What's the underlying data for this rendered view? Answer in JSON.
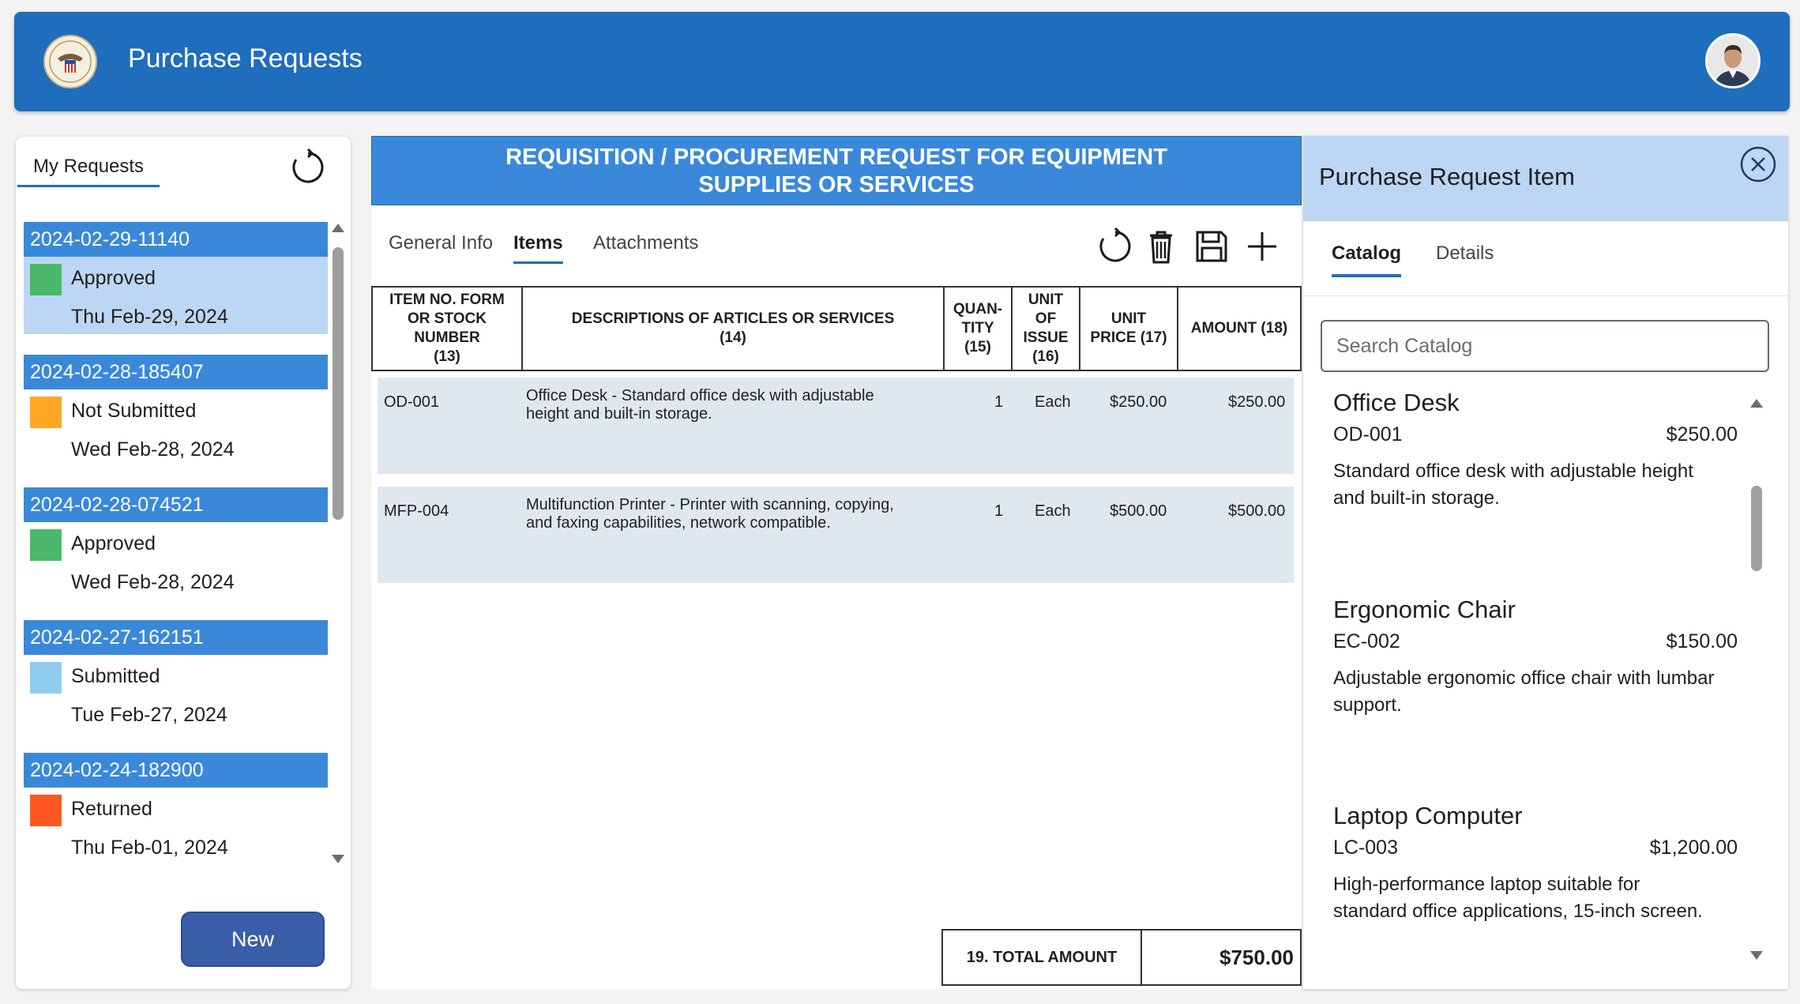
{
  "app": {
    "title": "Purchase Requests",
    "header_color": "#1f6dbd"
  },
  "left": {
    "tab_label": "My Requests",
    "requests": [
      {
        "id": "2024-02-29-11140",
        "status": "Approved",
        "date": "Thu Feb-29, 2024",
        "status_color": "#4cb86b",
        "selected": true
      },
      {
        "id": "2024-02-28-185407",
        "status": "Not Submitted",
        "date": "Wed Feb-28, 2024",
        "status_color": "#ffa726",
        "selected": false
      },
      {
        "id": "2024-02-28-074521",
        "status": "Approved",
        "date": "Wed Feb-28, 2024",
        "status_color": "#4cb86b",
        "selected": false
      },
      {
        "id": "2024-02-27-162151",
        "status": "Submitted",
        "date": "Tue Feb-27, 2024",
        "status_color": "#8fcdee",
        "selected": false
      },
      {
        "id": "2024-02-24-182900",
        "status": "Returned",
        "date": "Thu Feb-01, 2024",
        "status_color": "#ff5722",
        "selected": false
      }
    ],
    "new_button": "New"
  },
  "center": {
    "banner_line1": "REQUISITION / PROCUREMENT REQUEST FOR EQUIPMENT",
    "banner_line2": "SUPPLIES OR SERVICES",
    "tabs": [
      "General Info",
      "Items",
      "Attachments"
    ],
    "active_tab": "Items",
    "toolbar_icons": [
      "refresh-icon",
      "trash-icon",
      "save-icon",
      "add-icon"
    ],
    "columns": {
      "item_no": [
        "ITEM NO. FORM",
        "OR STOCK",
        "NUMBER",
        "(13)"
      ],
      "desc": [
        "DESCRIPTIONS OF ARTICLES OR SERVICES",
        "(14)"
      ],
      "qty": [
        "QUAN-",
        "TITY",
        "(15)"
      ],
      "unit_issue": [
        "UNIT",
        "OF",
        "ISSUE",
        "(16)"
      ],
      "unit_price": [
        "UNIT",
        "PRICE (17)"
      ],
      "amount": [
        "AMOUNT (18)"
      ]
    },
    "items": [
      {
        "item_no": "OD-001",
        "desc1": "Office Desk - Standard office desk with adjustable",
        "desc2": "height and built-in storage.",
        "qty": "1",
        "unit": "Each",
        "unit_price": "$250.00",
        "amount": "$250.00"
      },
      {
        "item_no": "MFP-004",
        "desc1": "Multifunction Printer - Printer with scanning, copying,",
        "desc2": "and faxing capabilities, network compatible.",
        "qty": "1",
        "unit": "Each",
        "unit_price": "$500.00",
        "amount": "$500.00"
      }
    ],
    "total_label": "19. TOTAL AMOUNT",
    "total_value": "$750.00"
  },
  "right": {
    "title": "Purchase Request Item",
    "tabs": [
      "Catalog",
      "Details"
    ],
    "active_tab": "Catalog",
    "search_placeholder": "Search Catalog",
    "catalog": [
      {
        "name": "Office Desk",
        "sku": "OD-001",
        "price": "$250.00",
        "desc1": "Standard office desk with adjustable height",
        "desc2": "and built-in storage."
      },
      {
        "name": "Ergonomic Chair",
        "sku": "EC-002",
        "price": "$150.00",
        "desc1": "Adjustable ergonomic office chair with lumbar",
        "desc2": "support."
      },
      {
        "name": "Laptop Computer",
        "sku": "LC-003",
        "price": "$1,200.00",
        "desc1": "High-performance laptop suitable for",
        "desc2": "standard office applications, 15-inch screen."
      }
    ]
  }
}
